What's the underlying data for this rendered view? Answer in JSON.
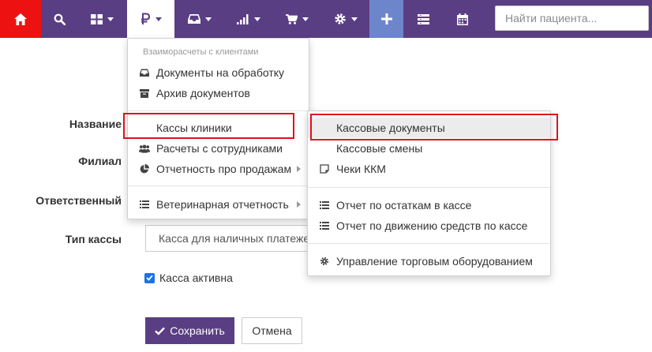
{
  "search": {
    "placeholder": "Найти пациента..."
  },
  "menu_finance": {
    "header": "Взаиморасчеты с клиентами",
    "items": [
      {
        "label": "Документы на обработку",
        "icon": "inbox-icon"
      },
      {
        "label": "Архив документов",
        "icon": "archive-icon"
      },
      {
        "label": "Кассы клиники",
        "icon": "none"
      },
      {
        "label": "Расчеты с сотрудниками",
        "icon": "users-icon"
      },
      {
        "label": "Отчетность про продажам",
        "icon": "pie-chart-icon"
      },
      {
        "label": "Ветеринарная отчетность",
        "icon": "list-icon"
      }
    ]
  },
  "submenu_cash": {
    "items": [
      {
        "label": "Кассовые документы"
      },
      {
        "label": "Кассовые смены"
      },
      {
        "label": "Чеки ККМ",
        "icon": "receipt-icon"
      },
      {
        "label": "Отчет по остаткам в кассе",
        "icon": "list-icon"
      },
      {
        "label": "Отчет по движению средств по кассе",
        "icon": "list-icon"
      },
      {
        "label": "Управление торговым оборудованием",
        "icon": "gear-icon"
      }
    ]
  },
  "form": {
    "name_label": "Название",
    "branch_label": "Филиал",
    "responsible_label": "Ответственный",
    "type_label": "Тип кассы",
    "type_value": "Касса для наличных платежей",
    "active_label": "Касса активна",
    "active_checked": true,
    "save_label": "Сохранить",
    "cancel_label": "Отмена"
  },
  "colors": {
    "nav_bg": "#5a3e83",
    "home_bg": "#ee1111",
    "plus_bg": "#6d85cb",
    "highlight_border": "#e0101d",
    "checkbox": "#1a73e8"
  }
}
